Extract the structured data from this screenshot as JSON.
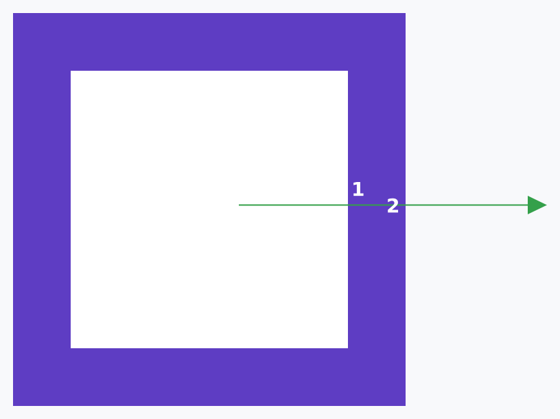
{
  "colors": {
    "background": "#f8f9fb",
    "frame": "#5e3dc3",
    "inner": "#ffffff",
    "ray": "#34a04a",
    "label_text": "#ffffff"
  },
  "labels": {
    "crossing_1": "1",
    "crossing_2": "2"
  },
  "icons": {
    "arrowhead": "arrow-right-icon"
  }
}
